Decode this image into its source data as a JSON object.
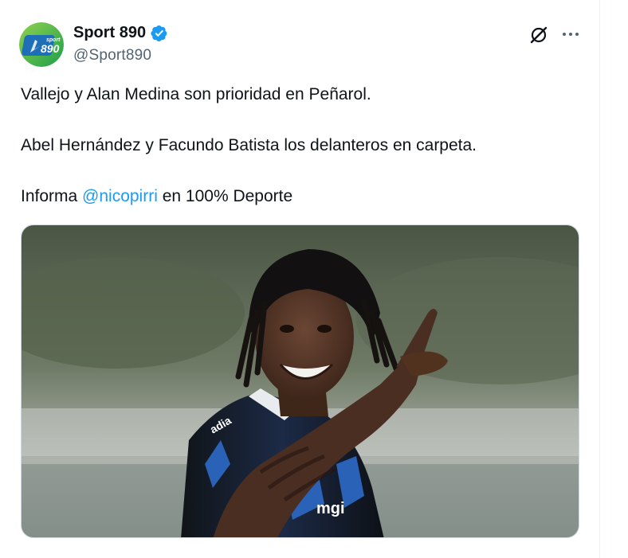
{
  "author": {
    "display_name": "Sport 890",
    "handle": "@Sport890",
    "avatar_text_top": "sport",
    "avatar_text_main": "890",
    "verified": true
  },
  "tweet": {
    "line1": "Vallejo y Alan Medina son prioridad en Peñarol.",
    "line2": "Abel Hernández y Facundo Batista los delanteros en carpeta.",
    "line3_prefix": "Informa ",
    "line3_mention": "@nicopirri",
    "line3_suffix": " en 100% Deporte"
  },
  "media": {
    "jersey_sponsor": "mgi",
    "jersey_text": "adia"
  },
  "colors": {
    "text": "#0f1419",
    "secondary": "#536471",
    "link": "#1d9bf0",
    "verified": "#1d9bf0"
  },
  "icons": {
    "verified": "verified-badge-icon",
    "grok": "grok-icon",
    "more": "more-dots-icon"
  }
}
